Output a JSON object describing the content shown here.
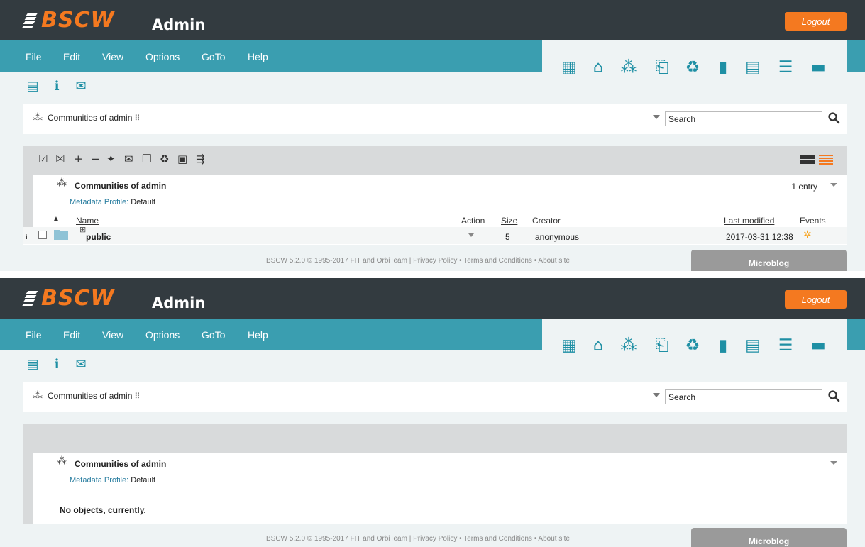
{
  "app": {
    "logo_text": "BSCW",
    "title": "Admin",
    "logout_label": "Logout"
  },
  "menu": {
    "items": [
      {
        "label": "File"
      },
      {
        "label": "Edit"
      },
      {
        "label": "View"
      },
      {
        "label": "Options"
      },
      {
        "label": "GoTo"
      },
      {
        "label": "Help"
      }
    ]
  },
  "toolbar_icons": [
    "grid-icon",
    "home-icon",
    "users-icon",
    "clipboard-icon",
    "trash-icon",
    "address-book-icon",
    "calendar-icon",
    "tasks-icon",
    "briefcase-icon"
  ],
  "sub_icons": [
    "list-icon",
    "info-icon",
    "mail-file-icon"
  ],
  "breadcrumb": {
    "label": "Communities of admin",
    "suffix_icon": "member-grid-icon"
  },
  "search": {
    "value": "Search"
  },
  "folder": {
    "title": "Communities of admin",
    "meta_label": "Metadata Profile:",
    "meta_value": "Default",
    "entry_count": "1 entry"
  },
  "columns": {
    "name": "Name",
    "action": "Action",
    "size": "Size",
    "creator": "Creator",
    "last_modified": "Last modified",
    "events": "Events"
  },
  "rows": [
    {
      "name": "public",
      "size": "5",
      "creator": "anonymous",
      "last_modified": "2017-03-31 12:38"
    }
  ],
  "empty_message": "No objects, currently.",
  "footer": {
    "text": "BSCW 5.2.0 © 1995-2017 FIT and OrbiTeam | Privacy Policy  •  Terms and Conditions  •  About site"
  },
  "microblog_label": "Microblog",
  "colors": {
    "topbar": "#333b40",
    "menubar": "#3a9eb0",
    "accent": "#f47920",
    "icon": "#1e8fa4"
  }
}
